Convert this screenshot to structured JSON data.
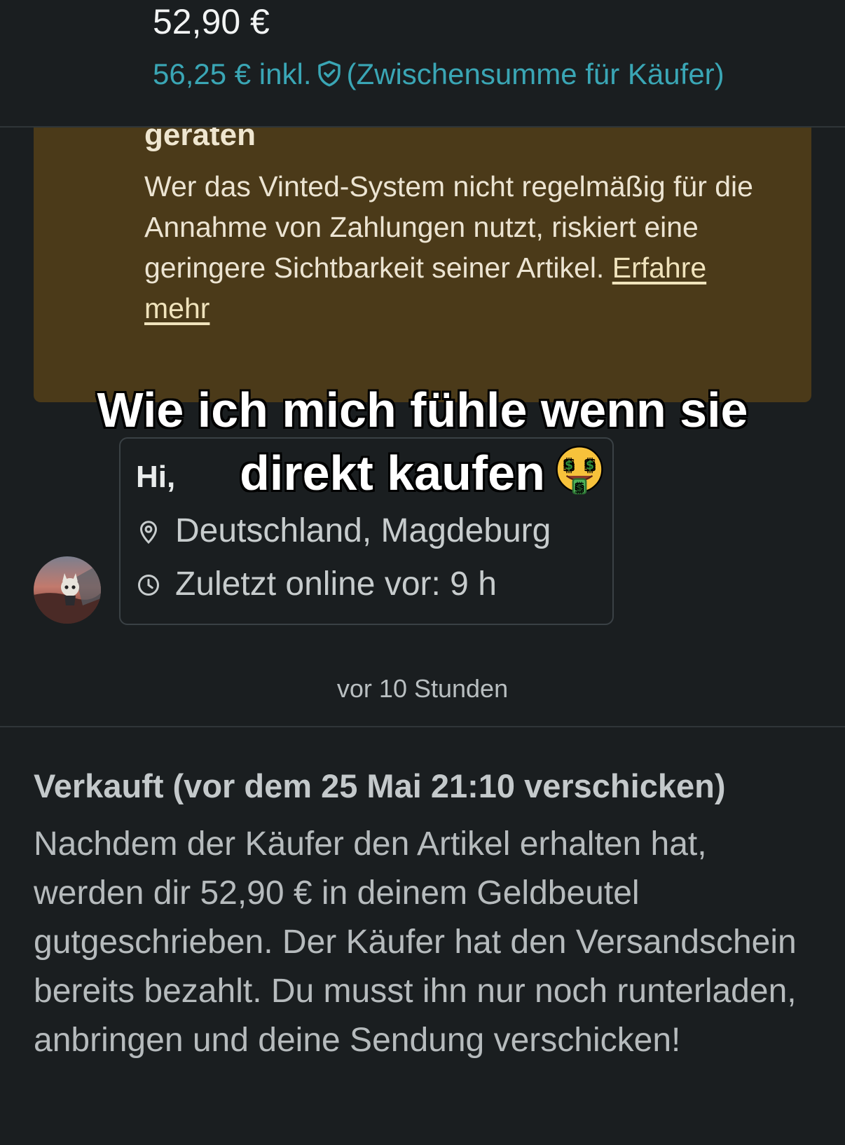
{
  "header": {
    "price": "52,90 €",
    "price_incl_prefix": "56,25 € inkl.",
    "price_incl_suffix": "(Zwischensumme für Käufer)",
    "shield_icon": "shield-check-icon",
    "accent_color": "#3aa6b5"
  },
  "warning": {
    "title": "geraten",
    "body": "Wer das Vinted-System nicht regelmäßig für die Annahme von Zahlungen nutzt, riskiert eine geringere Sichtbarkeit seiner Artikel. ",
    "link": "Erfahre mehr",
    "background_color": "#4b3a19"
  },
  "caption": {
    "line1": "Wie ich mich fühle wenn sie",
    "line2": "direkt kaufen",
    "emoji": "money-mouth-face"
  },
  "profile": {
    "greeting": "Hi,",
    "location": "Deutschland, Magdeburg",
    "location_icon": "location-pin-icon",
    "last_online": "Zuletzt online vor: 9 h",
    "clock_icon": "clock-icon"
  },
  "message": {
    "timestamp": "vor 10 Stunden"
  },
  "sold": {
    "title": "Verkauft (vor dem 25 Mai 21:10 verschicken)",
    "body": "Nachdem der Käufer den Artikel erhalten hat, werden dir 52,90 € in deinem Geldbeutel gutgeschrieben. Der Käufer hat den Versandschein bereits bezahlt. Du musst ihn nur noch runterladen, anbringen und deine Sendung verschicken!"
  }
}
